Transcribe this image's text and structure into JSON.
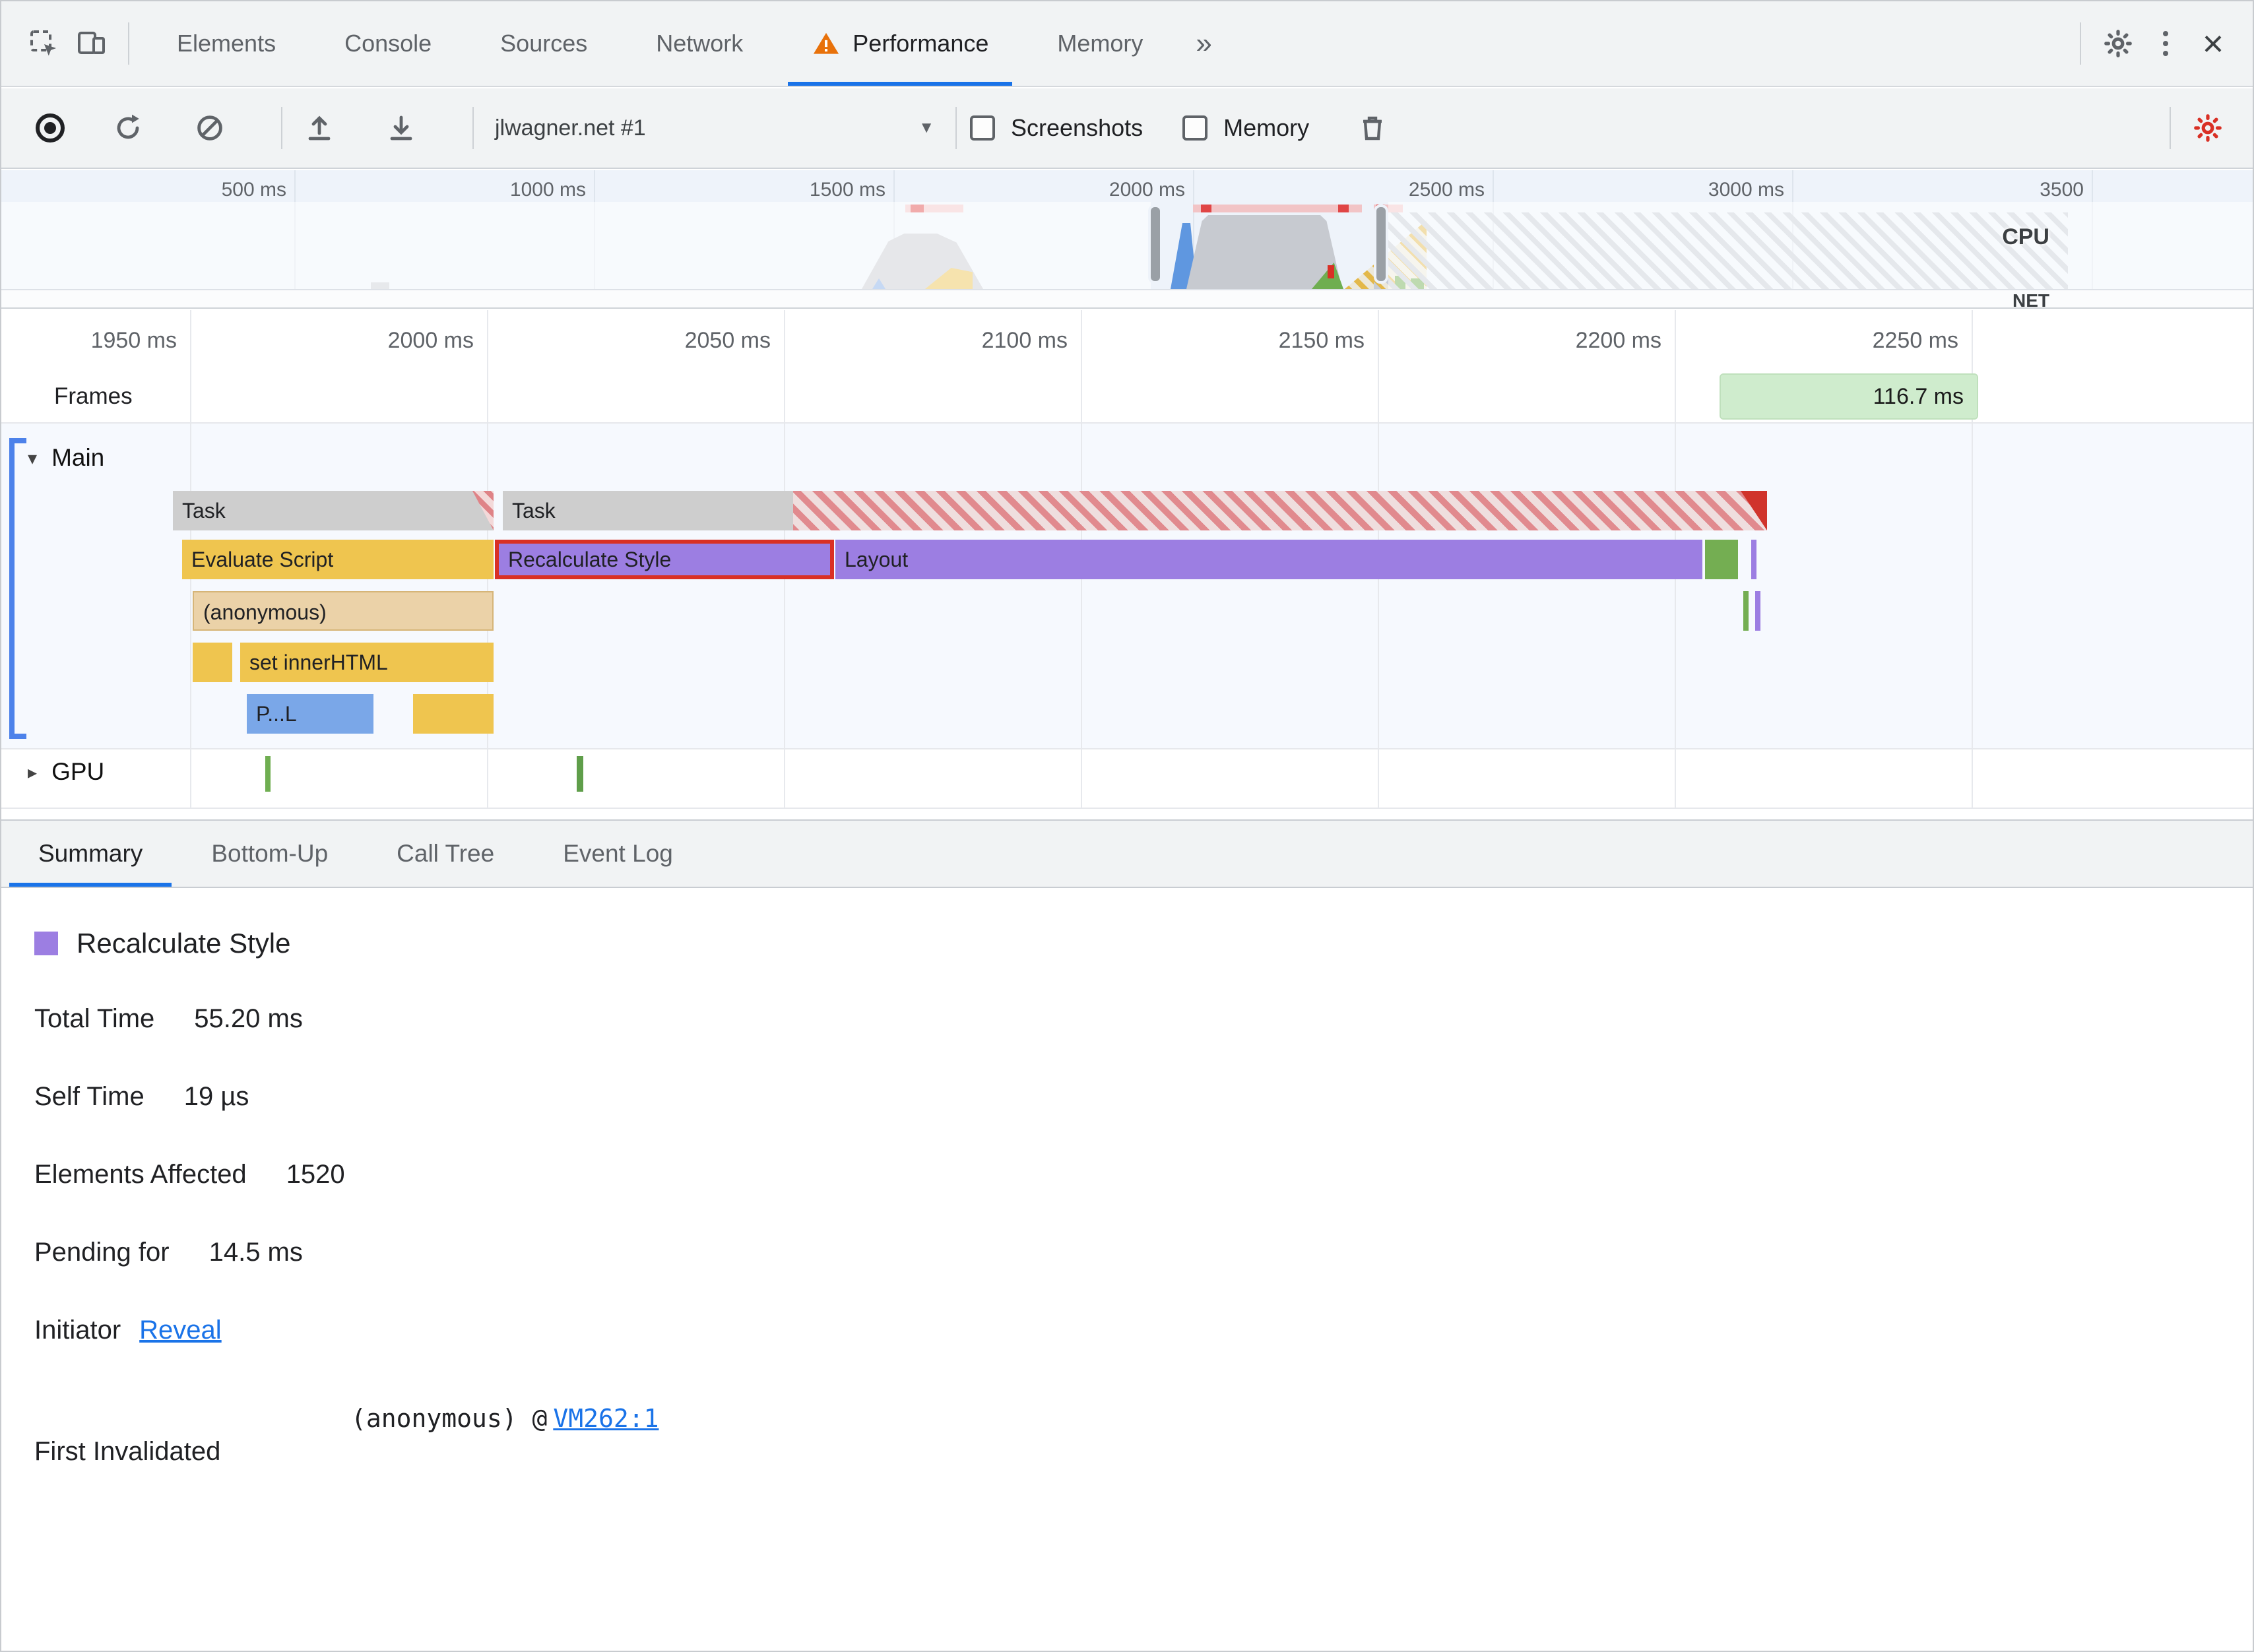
{
  "tabbar": {
    "tabs": [
      {
        "label": "Elements"
      },
      {
        "label": "Console"
      },
      {
        "label": "Sources"
      },
      {
        "label": "Network"
      },
      {
        "label": "Performance"
      },
      {
        "label": "Memory"
      }
    ],
    "active_tab": "Performance"
  },
  "glyphs": {
    "more_tabs": "»",
    "close": "×",
    "dropdown_caret": "▼",
    "expander_expanded": "▾",
    "expander_collapsed": "▸"
  },
  "toolbar": {
    "profile_name": "jlwagner.net #1",
    "screenshots_label": "Screenshots",
    "memory_label": "Memory"
  },
  "overview": {
    "time_labels": [
      "500 ms",
      "1000 ms",
      "1500 ms",
      "2000 ms",
      "2500 ms",
      "3000 ms",
      "3500"
    ],
    "cpu_label": "CPU",
    "net_label": "NET"
  },
  "timeline": {
    "ruler_labels": [
      "1950 ms",
      "2000 ms",
      "2050 ms",
      "2100 ms",
      "2150 ms",
      "2200 ms",
      "2250 ms"
    ],
    "frames_label": "Frames",
    "frame_duration": "116.7 ms",
    "main_label": "Main",
    "gpu_label": "GPU",
    "bars": {
      "task1": "Task",
      "task2": "Task",
      "evaluate_script": "Evaluate Script",
      "recalculate_style": "Recalculate Style",
      "layout": "Layout",
      "anonymous": "(anonymous)",
      "set_inner_html": "set innerHTML",
      "parse_html": "P...L"
    }
  },
  "bottom_tabs": [
    {
      "label": "Summary"
    },
    {
      "label": "Bottom-Up"
    },
    {
      "label": "Call Tree"
    },
    {
      "label": "Event Log"
    }
  ],
  "summary": {
    "title": "Recalculate Style",
    "rows": [
      {
        "label": "Total Time",
        "value": "55.20 ms"
      },
      {
        "label": "Self Time",
        "value": "19 µs"
      },
      {
        "label": "Elements Affected",
        "value": "1520"
      },
      {
        "label": "Pending for",
        "value": "14.5 ms"
      }
    ],
    "initiator_label": "Initiator",
    "initiator_link": "Reveal",
    "first_invalidated_label": "First Invalidated",
    "first_invalidated_code": "(anonymous) @",
    "first_invalidated_link": "VM262:1"
  },
  "colors": {
    "accent_blue": "#1a73e8",
    "warning_orange": "#e8710a",
    "record_red_gear": "#d93025",
    "task_gray": "#cecece",
    "scripting_yellow": "#efc54f",
    "rendering_purple": "#9c7ee2",
    "function_tan": "#ebd2a8",
    "parse_blue": "#7aa7e8",
    "gpu_green": "#74ae52",
    "frames_green": "#cfeccd",
    "selection_red": "#d93025"
  }
}
